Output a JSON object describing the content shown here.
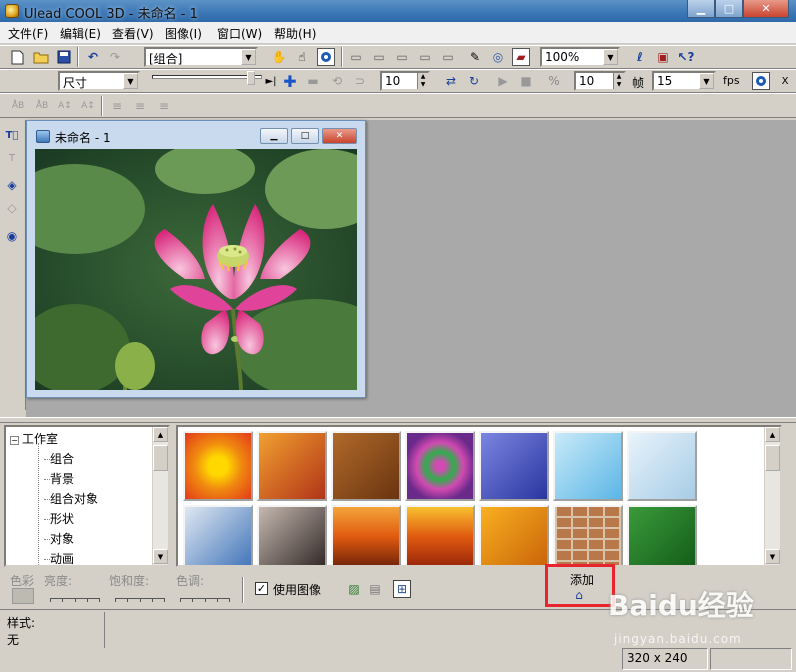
{
  "window": {
    "title": "Ulead COOL 3D - 未命名 - 1"
  },
  "menu": [
    "文件(F)",
    "编辑(E)",
    "查看(V)",
    "图像(I)",
    "窗口(W)",
    "帮助(H)"
  ],
  "toolbar1": {
    "object_select": "[组合]",
    "zoom": "100%"
  },
  "toolbar2": {
    "size_select": "尺寸",
    "frame_value": "10",
    "frame_count": "10",
    "frame_label": "帧",
    "fps_value": "15",
    "fps_label": "fps"
  },
  "document": {
    "title": "未命名 - 1"
  },
  "tree": {
    "root": "工作室",
    "items": [
      "组合",
      "背景",
      "组合对象",
      "形状",
      "对象",
      "动画"
    ]
  },
  "thumbnails": [
    {
      "name": "radial-sun",
      "colors": [
        "#ffd800",
        "#e23a1a"
      ]
    },
    {
      "name": "fire-texture",
      "colors": [
        "#f2a030",
        "#b03418"
      ]
    },
    {
      "name": "wood",
      "colors": [
        "#b06a2a",
        "#6a3410"
      ]
    },
    {
      "name": "swirl",
      "colors": [
        "#2fae4a",
        "#d24ab2"
      ]
    },
    {
      "name": "water",
      "colors": [
        "#7b86e0",
        "#2a35a0"
      ]
    },
    {
      "name": "ice-blue",
      "colors": [
        "#c9eaf8",
        "#5bb6e6"
      ]
    },
    {
      "name": "snow",
      "colors": [
        "#e8f3fb",
        "#a7cce6"
      ]
    },
    {
      "name": "clouds",
      "colors": [
        "#dfe8f2",
        "#3a6fb6"
      ]
    },
    {
      "name": "dark-clouds",
      "colors": [
        "#c6b8b0",
        "#2a2220"
      ]
    },
    {
      "name": "sunset-sea",
      "colors": [
        "#f4a43a",
        "#5a1808"
      ]
    },
    {
      "name": "red-sunset",
      "colors": [
        "#f8c030",
        "#8a1a08"
      ]
    },
    {
      "name": "orange-fabric",
      "colors": [
        "#f8b020",
        "#c86008"
      ]
    },
    {
      "name": "brick",
      "colors": [
        "#b8784a",
        "#7a4a2a"
      ]
    },
    {
      "name": "green-leaf",
      "colors": [
        "#3a9a3a",
        "#125a18"
      ]
    }
  ],
  "properties": {
    "color_label": "色彩",
    "brightness_label": "亮度:",
    "saturation_label": "饱和度:",
    "hue_label": "色调:",
    "use_image_label": "使用图像",
    "use_image_checked": true,
    "add_label": "添加"
  },
  "status": {
    "style_label": "样式:",
    "style_value": "无",
    "dimensions": "320 x 240"
  },
  "watermark": {
    "text": "Baidu经验",
    "sub": "jingyan.baidu.com"
  }
}
